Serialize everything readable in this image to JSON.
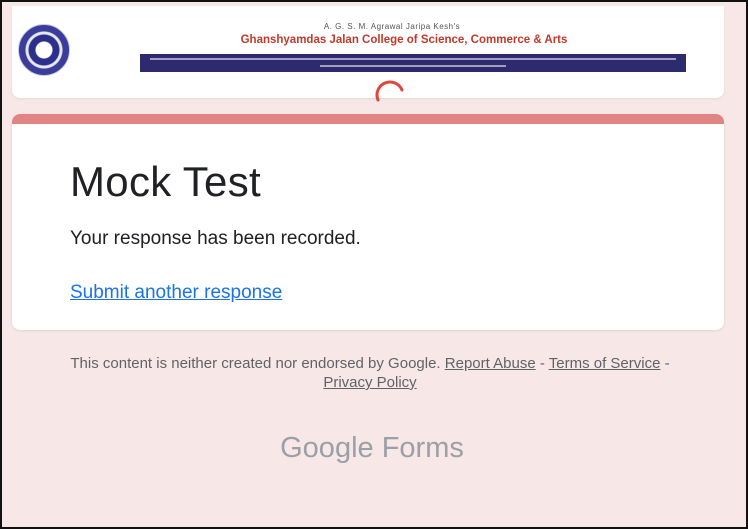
{
  "header": {
    "trust_line": "A. G. S. M. Agrawal Jaripa Kesh's",
    "college_name": "Ghanshyamdas Jalan College of Science, Commerce & Arts",
    "logo_icon": "college-seal-icon",
    "spinner_icon": "loading-spinner-icon",
    "colors": {
      "college_name": "#c0392b",
      "bar": "#2d2a6e",
      "spinner": "#e0463f"
    }
  },
  "card": {
    "accent_color": "#e08583",
    "title": "Mock Test",
    "confirmation": "Your response has been recorded.",
    "submit_another": "Submit another response"
  },
  "footer": {
    "disclaimer_text": "This content is neither created nor endorsed by Google.",
    "report_abuse": "Report Abuse",
    "separator": " - ",
    "terms": "Terms of Service",
    "privacy": "Privacy Policy",
    "brand_google": "Google",
    "brand_forms": "Forms"
  },
  "colors": {
    "page_background": "#f7e8e7",
    "link": "#1a73e8"
  }
}
